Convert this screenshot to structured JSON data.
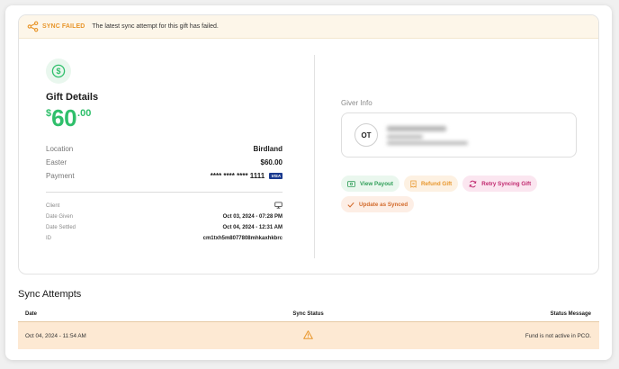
{
  "banner": {
    "label": "SYNC FAILED",
    "message": "The latest sync attempt for this gift has failed."
  },
  "gift": {
    "title": "Gift Details",
    "currency": "$",
    "amount_whole": "60",
    "amount_cents": ".00",
    "location_label": "Location",
    "location_value": "Birdland",
    "fund_label": "Easter",
    "fund_value": "$60.00",
    "payment_label": "Payment",
    "payment_value": "**** **** **** 1111",
    "card_brand": "VISA",
    "client_label": "Client",
    "client_icon": "desktop-icon",
    "date_given_label": "Date Given",
    "date_given_value": "Oct 03, 2024 - 07:28 PM",
    "date_settled_label": "Date Settled",
    "date_settled_value": "Oct 04, 2024 - 12:31 AM",
    "id_label": "ID",
    "id_value": "cm1txh5m8077808mhkaxhkbrc"
  },
  "giver": {
    "label": "Giver Info",
    "initials": "OT"
  },
  "actions": {
    "view_payout": "View Payout",
    "refund": "Refund Gift",
    "retry": "Retry Syncing Gift",
    "update_synced": "Update as Synced"
  },
  "sync": {
    "title": "Sync Attempts",
    "columns": {
      "date": "Date",
      "status": "Sync Status",
      "message": "Status Message"
    },
    "rows": [
      {
        "date": "Oct 04, 2024 - 11:54 AM",
        "status_icon": "warning-icon",
        "message": "Fund is not active in PCO."
      }
    ]
  },
  "colors": {
    "accent_green": "#2fbf6b",
    "warning_orange": "#e8962b",
    "retry_pink": "#c0286e",
    "row_highlight": "#fde9d3"
  }
}
